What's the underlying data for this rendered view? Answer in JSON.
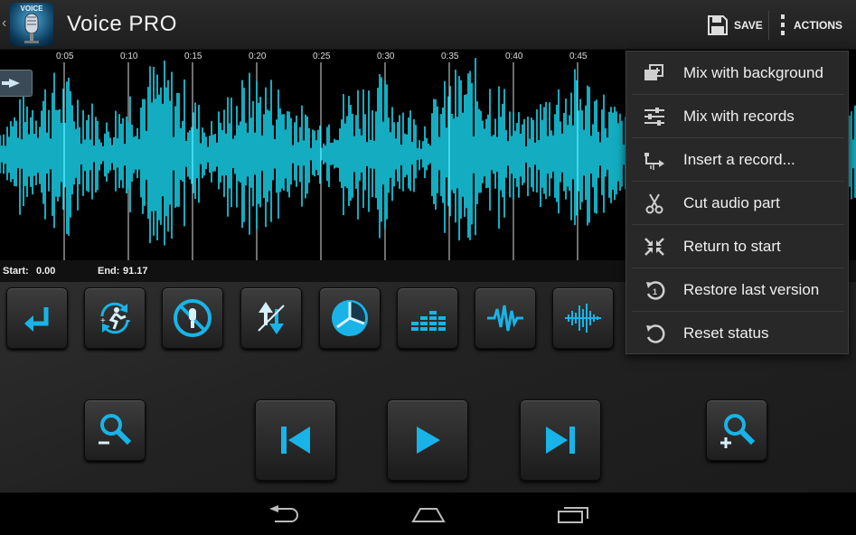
{
  "app": {
    "title": "Voice PRO",
    "logo_text": "VOICE"
  },
  "actionbar": {
    "save_label": "SAVE",
    "actions_label": "ACTIONS"
  },
  "waveform": {
    "time_ticks": [
      "0:05",
      "0:10",
      "0:15",
      "0:20",
      "0:25",
      "0:30",
      "0:35",
      "0:40",
      "0:45"
    ],
    "start_label": "Start:",
    "start_value": "0.00",
    "end_label": "End:",
    "end_value": "91.17",
    "wave_color": "#18d8f0"
  },
  "tools": [
    {
      "name": "undo-icon"
    },
    {
      "name": "loop-speed-icon"
    },
    {
      "name": "no-voice-icon"
    },
    {
      "name": "pitch-shift-icon"
    },
    {
      "name": "pie-timer-icon"
    },
    {
      "name": "equalizer-icon"
    },
    {
      "name": "waveform-effect-icon"
    },
    {
      "name": "echo-effect-icon"
    }
  ],
  "transport": [
    "zoom-out-icon",
    "skip-back-icon",
    "play-icon",
    "skip-forward-icon",
    "zoom-in-icon"
  ],
  "menu": {
    "items": [
      {
        "label": "Mix with background",
        "icon": "mix-background-icon"
      },
      {
        "label": "Mix with records",
        "icon": "mix-records-icon"
      },
      {
        "label": "Insert a record...",
        "icon": "insert-record-icon"
      },
      {
        "label": "Cut audio part",
        "icon": "scissors-icon"
      },
      {
        "label": "Return to start",
        "icon": "return-to-start-icon"
      },
      {
        "label": "Restore last version",
        "icon": "restore-icon"
      },
      {
        "label": "Reset status",
        "icon": "reset-icon"
      }
    ]
  },
  "colors": {
    "accent": "#18b4e8",
    "waveform": "#18d8f0",
    "button": "#2e2e2e"
  }
}
